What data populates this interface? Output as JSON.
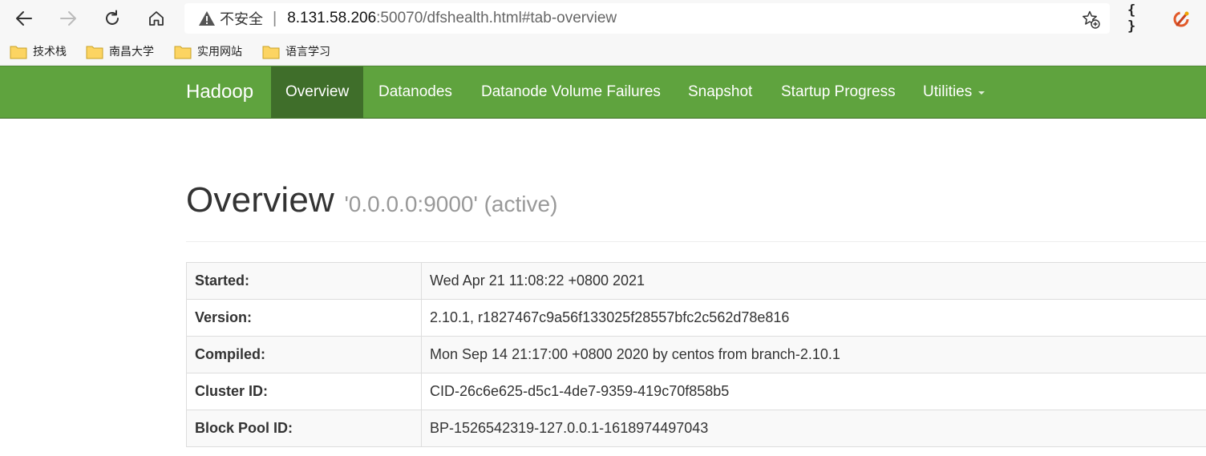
{
  "browser": {
    "insecure_label": "不安全",
    "separator": "|",
    "url_host": "8.131.58.206",
    "url_rest": ":50070/dfshealth.html#tab-overview",
    "extension_label": "{ }"
  },
  "bookmarks": [
    {
      "label": "技术栈"
    },
    {
      "label": "南昌大学"
    },
    {
      "label": "实用网站"
    },
    {
      "label": "语言学习"
    }
  ],
  "navbar": {
    "brand": "Hadoop",
    "items": [
      {
        "label": "Overview",
        "active": true
      },
      {
        "label": "Datanodes"
      },
      {
        "label": "Datanode Volume Failures"
      },
      {
        "label": "Snapshot"
      },
      {
        "label": "Startup Progress"
      },
      {
        "label": "Utilities",
        "dropdown": true
      }
    ],
    "color": "#5fa33e",
    "active_color": "#3f6e2a"
  },
  "overview": {
    "title": "Overview",
    "subtitle": "'0.0.0.0:9000' (active)",
    "rows": [
      {
        "key": "Started:",
        "value": "Wed Apr 21 11:08:22 +0800 2021"
      },
      {
        "key": "Version:",
        "value": "2.10.1, r1827467c9a56f133025f28557bfc2c562d78e816"
      },
      {
        "key": "Compiled:",
        "value": "Mon Sep 14 21:17:00 +0800 2020 by centos from branch-2.10.1"
      },
      {
        "key": "Cluster ID:",
        "value": "CID-26c6e625-d5c1-4de7-9359-419c70f858b5"
      },
      {
        "key": "Block Pool ID:",
        "value": "BP-1526542319-127.0.0.1-1618974497043"
      }
    ]
  },
  "icons": [
    "back-icon",
    "forward-icon",
    "reload-icon",
    "home-icon",
    "warning-icon",
    "add-favorite-icon",
    "folder-icon",
    "extension-logo-icon"
  ]
}
